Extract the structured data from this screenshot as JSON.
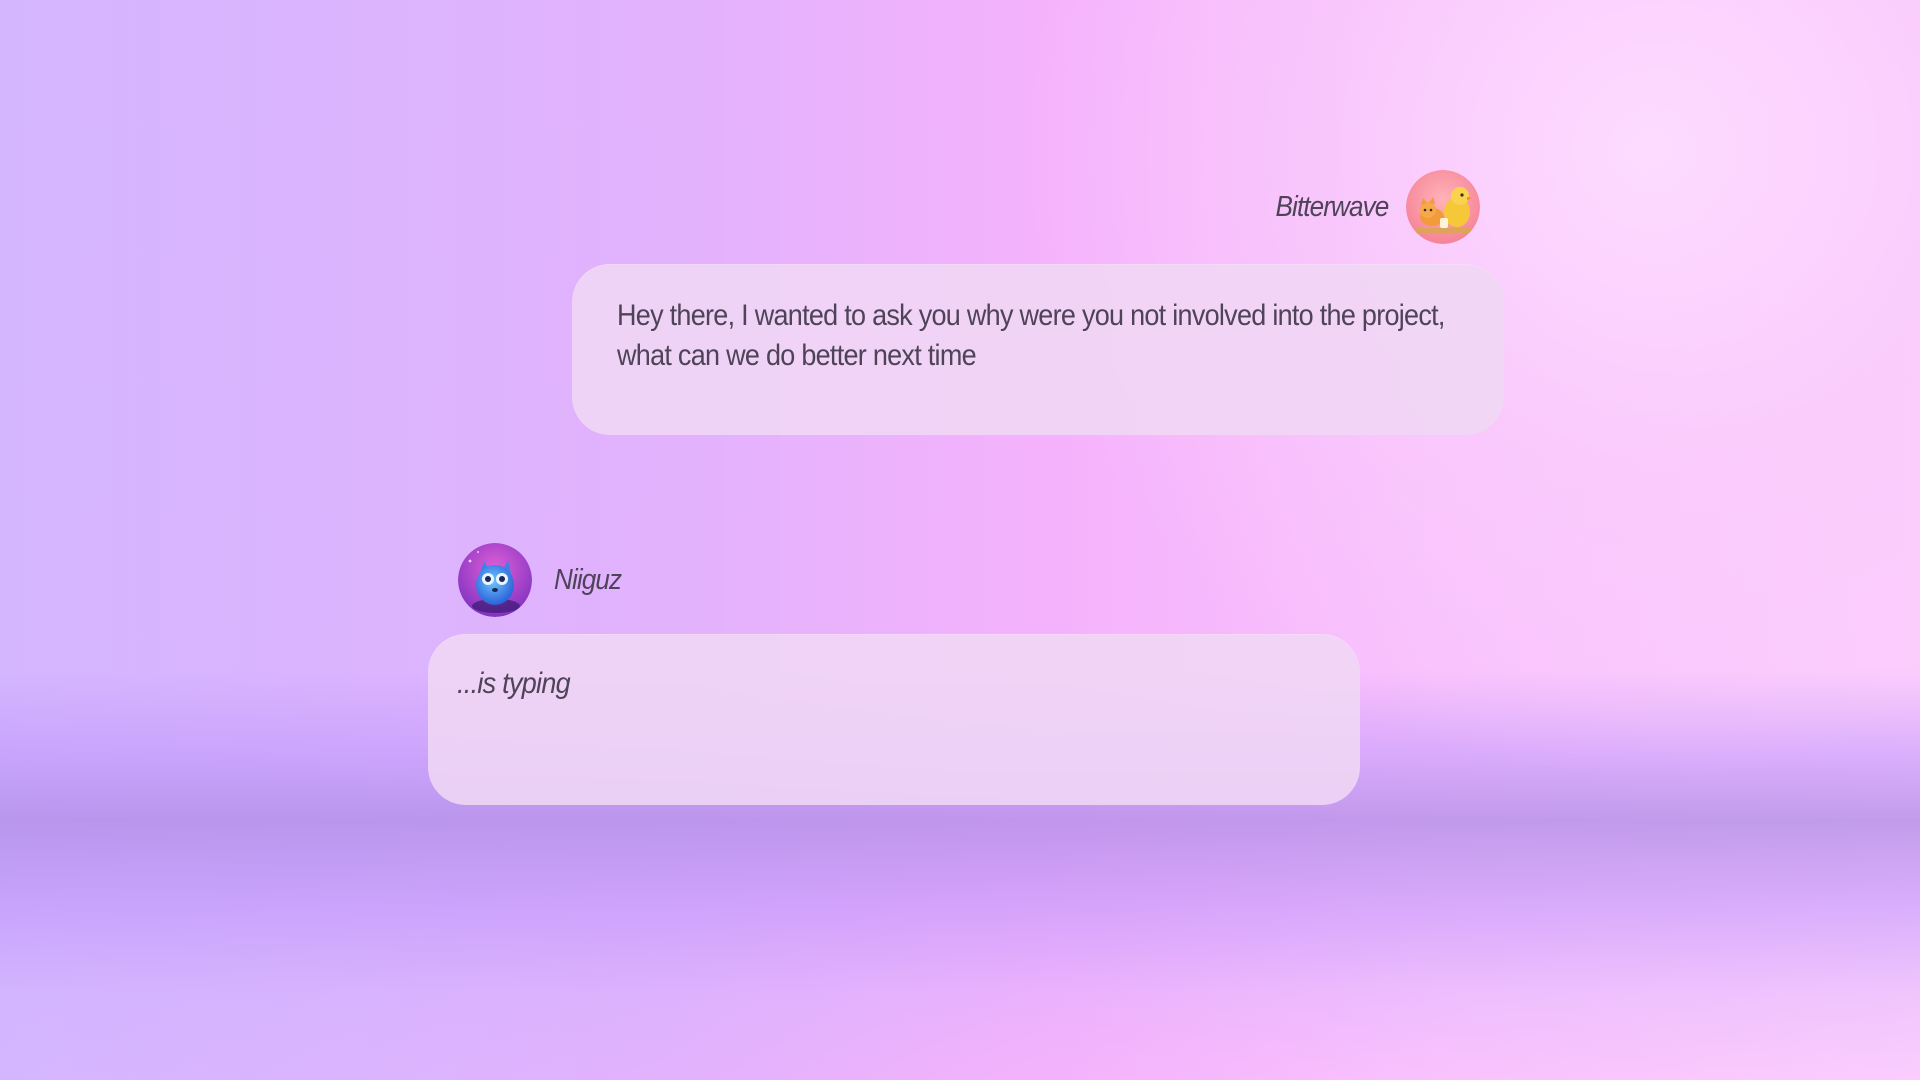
{
  "conversation": {
    "messages": [
      {
        "author": "Bitterwave",
        "avatar_icon": "bitterwave-avatar",
        "text": "Hey there, I wanted to ask you why were you not involved into the project, what can we do better next time"
      },
      {
        "author": "Niiguz",
        "avatar_icon": "niiguz-avatar",
        "status": "...is typing"
      }
    ]
  },
  "colors": {
    "bubble": "#EFD6F5",
    "text": "#4E4358",
    "bg_left": "#D4B6FF",
    "bg_right": "#FBCDFD"
  }
}
